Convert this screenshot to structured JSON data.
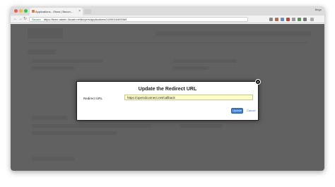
{
  "browser": {
    "tab_title": "Applications - Show | Becon...",
    "user": "Bego",
    "secure_label": "Secure",
    "url": "https://fsme.admin.3scale.net/buyers/applications/1409016405369"
  },
  "modal": {
    "title": "Update the Redirect URL",
    "close_symbol": "×",
    "field_label": "Redirect URL",
    "field_value": "https://openidconnect.net/callback",
    "update_label": "Update",
    "cancel_label": "Cancel"
  },
  "colors": {
    "accent": "#3b7dd8",
    "input_bg": "#fdfdc9",
    "overlay": "rgba(0,0,0,0.62)"
  }
}
